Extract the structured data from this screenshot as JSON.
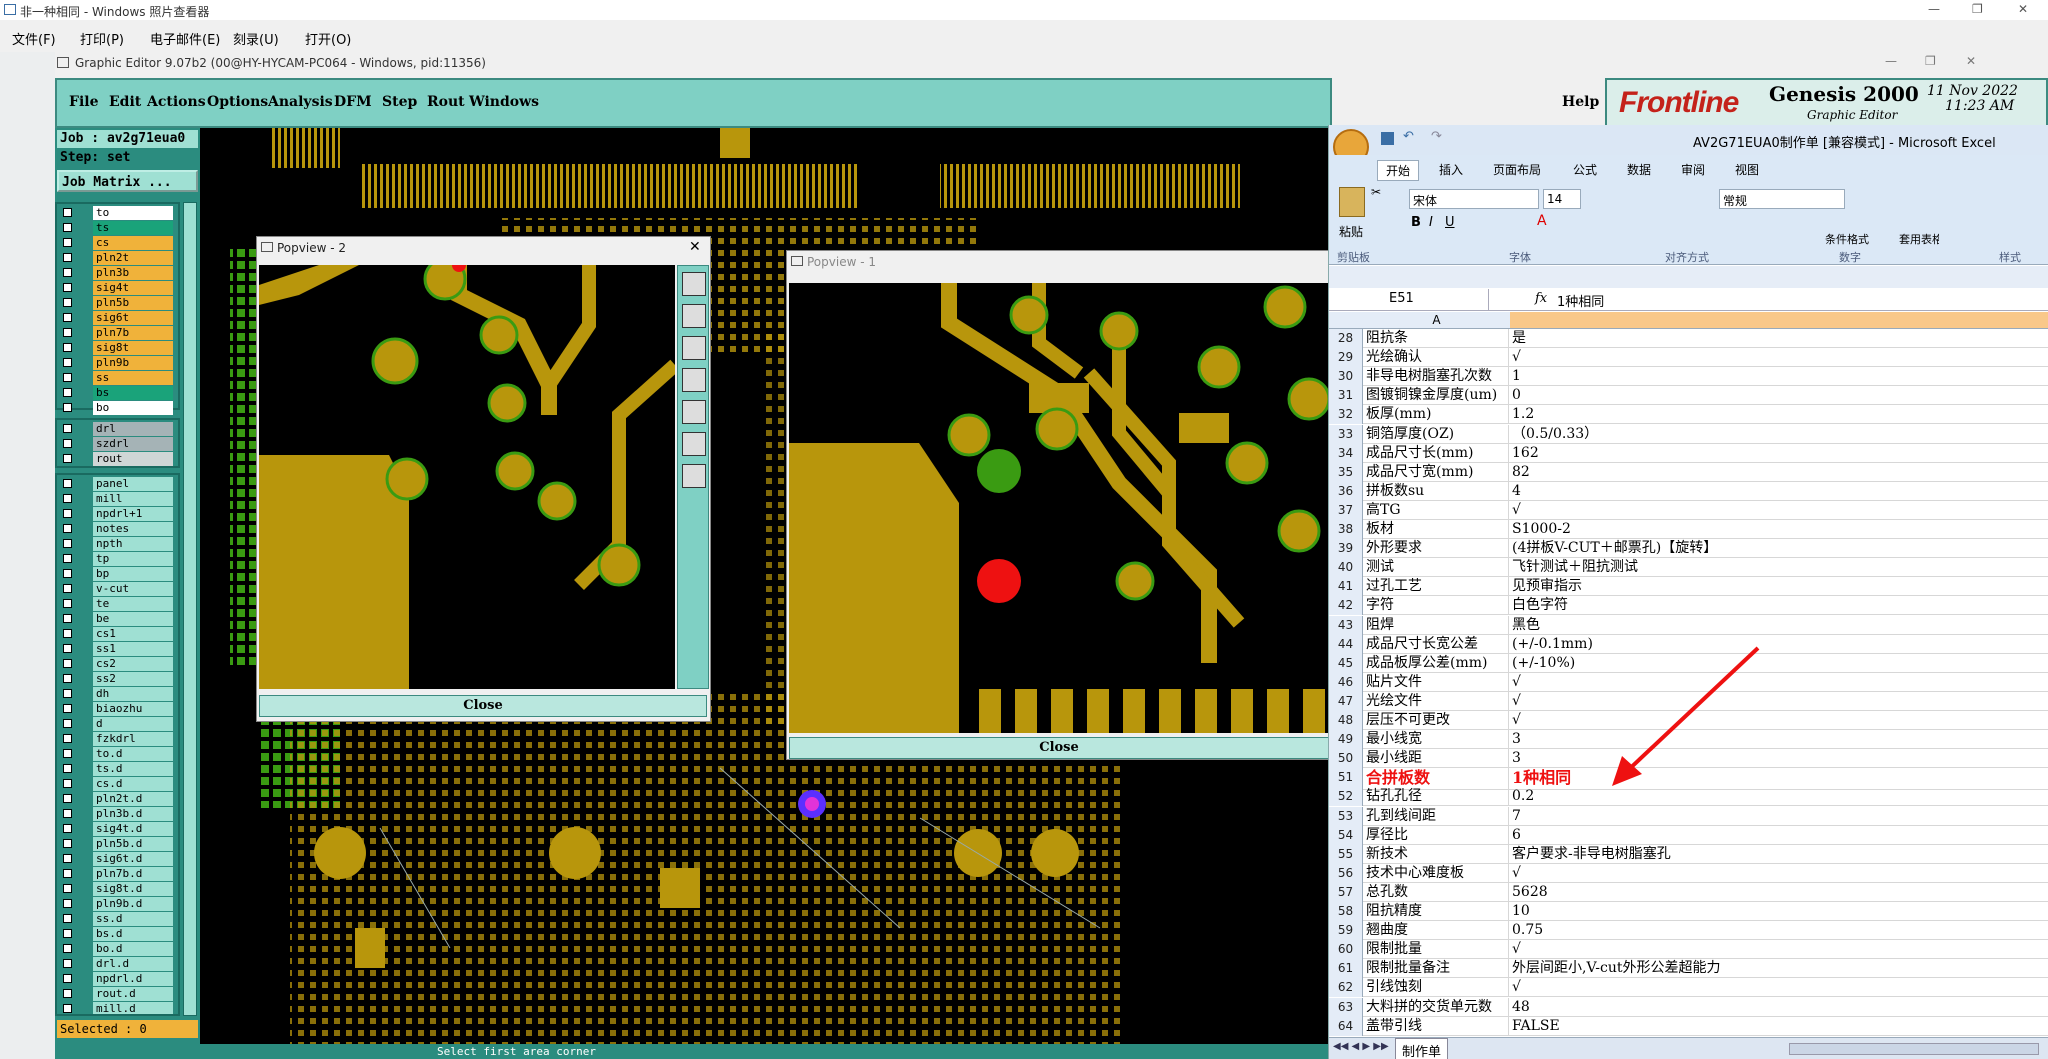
{
  "viewer": {
    "title": "非一种相同 - Windows 照片查看器",
    "menu": [
      "文件(F)",
      "打印(P)",
      "电子邮件(E)",
      "刻录(U)",
      "打开(O)"
    ]
  },
  "genesis": {
    "title": "Graphic Editor 9.07b2 (00@HY-HYCAM-PC064 - Windows, pid:11356)",
    "menu": [
      "File",
      "Edit",
      "Actions",
      "Options",
      "Analysis",
      "DFM",
      "Step",
      "Rout",
      "Windows"
    ],
    "help": "Help",
    "brand": "Frontline",
    "product": "Genesis 2000",
    "subproduct": "Graphic Editor",
    "date": "11 Nov 2022",
    "time": "11:23 AM",
    "job": "Job : av2g71eua0",
    "step": "Step: set",
    "job_matrix": "Job Matrix ...",
    "selected": "Selected : 0",
    "status_text": "Select first area corner",
    "colors": {
      "teal": "#7fd0c4",
      "panel": "#2b8c7f",
      "copper": "#b8960c",
      "pad_green": "#3a9b12"
    },
    "layers_group1": [
      {
        "name": "to",
        "color": "#ffffff"
      },
      {
        "name": "ts",
        "color": "#1aa37a"
      },
      {
        "name": "cs",
        "color": "#f0b23a"
      },
      {
        "name": "pln2t",
        "color": "#f0b23a"
      },
      {
        "name": "pln3b",
        "color": "#f0b23a"
      },
      {
        "name": "sig4t",
        "color": "#f0b23a"
      },
      {
        "name": "pln5b",
        "color": "#f0b23a"
      },
      {
        "name": "sig6t",
        "color": "#f0b23a"
      },
      {
        "name": "pln7b",
        "color": "#f0b23a"
      },
      {
        "name": "sig8t",
        "color": "#f0b23a"
      },
      {
        "name": "pln9b",
        "color": "#f0b23a"
      },
      {
        "name": "ss",
        "color": "#f0b23a"
      },
      {
        "name": "bs",
        "color": "#1aa37a"
      },
      {
        "name": "bo",
        "color": "#ffffff"
      }
    ],
    "layers_group2": [
      {
        "name": "drl",
        "color": "#a5b3b6"
      },
      {
        "name": "szdrl",
        "color": "#a5b3b6"
      },
      {
        "name": "rout",
        "color": "#cfd6d6"
      }
    ],
    "layers_group3": [
      "panel",
      "mill",
      "npdrl+1",
      "notes",
      "npth",
      "tp",
      "bp",
      "v-cut",
      "te",
      "be",
      "cs1",
      "ss1",
      "cs2",
      "ss2",
      "dh",
      "biaozhu",
      "d",
      "fzkdrl",
      "to.d",
      "ts.d",
      "cs.d",
      "pln2t.d",
      "pln3b.d",
      "sig4t.d",
      "pln5b.d",
      "sig6t.d",
      "pln7b.d",
      "sig8t.d",
      "pln9b.d",
      "ss.d",
      "bs.d",
      "bo.d",
      "drl.d",
      "npdrl.d",
      "rout.d",
      "mill.d"
    ],
    "popview2": {
      "title": "Popview - 2",
      "close": "Close"
    },
    "popview1": {
      "title": "Popview - 1",
      "close": "Close"
    }
  },
  "excel": {
    "title": "AV2G71EUA0制作单 [兼容模式] - Microsoft Excel",
    "tabs": [
      "开始",
      "插入",
      "页面布局",
      "公式",
      "数据",
      "审阅",
      "视图"
    ],
    "font_name": "宋体",
    "font_size": "14",
    "number_format": "常规",
    "paste": "粘贴",
    "groups": [
      "剪贴板",
      "字体",
      "对齐方式",
      "数字",
      "样式"
    ],
    "cond_format": "条件格式",
    "table_format": "套用表格格式",
    "name_box": "E51",
    "formula": "1种相同",
    "col_a": "A",
    "sheet_tab": "制作单",
    "rows": [
      {
        "n": "28",
        "a": "阻抗条",
        "b": "是"
      },
      {
        "n": "29",
        "a": "光绘确认",
        "b": "√"
      },
      {
        "n": "30",
        "a": "非导电树脂塞孔次数",
        "b": "1"
      },
      {
        "n": "31",
        "a": "图镀铜镍金厚度(um)",
        "b": "0"
      },
      {
        "n": "32",
        "a": "板厚(mm)",
        "b": "1.2"
      },
      {
        "n": "33",
        "a": "铜箔厚度(OZ)",
        "b": "（0.5/0.33）"
      },
      {
        "n": "34",
        "a": "成品尺寸长(mm)",
        "b": "162"
      },
      {
        "n": "35",
        "a": "成品尺寸宽(mm)",
        "b": "82"
      },
      {
        "n": "36",
        "a": "拼板数su",
        "b": "4"
      },
      {
        "n": "37",
        "a": "高TG",
        "b": "√"
      },
      {
        "n": "38",
        "a": "板材",
        "b": "S1000-2"
      },
      {
        "n": "39",
        "a": "外形要求",
        "b": "(4拼板V-CUT＋邮票孔)【旋转】"
      },
      {
        "n": "40",
        "a": "测试",
        "b": "飞针测试＋阻抗测试"
      },
      {
        "n": "41",
        "a": "过孔工艺",
        "b": "见预审指示"
      },
      {
        "n": "42",
        "a": "字符",
        "b": "白色字符"
      },
      {
        "n": "43",
        "a": "阻焊",
        "b": "黑色"
      },
      {
        "n": "44",
        "a": "成品尺寸长宽公差",
        "b": "(+/-0.1mm)"
      },
      {
        "n": "45",
        "a": "成品板厚公差(mm)",
        "b": "(+/-10%)"
      },
      {
        "n": "46",
        "a": "贴片文件",
        "b": "√"
      },
      {
        "n": "47",
        "a": "光绘文件",
        "b": "√"
      },
      {
        "n": "48",
        "a": "层压不可更改",
        "b": "√"
      },
      {
        "n": "49",
        "a": "最小线宽",
        "b": "3"
      },
      {
        "n": "50",
        "a": "最小线距",
        "b": "3"
      },
      {
        "n": "51",
        "a": "合拼板数",
        "b": "1种相同"
      },
      {
        "n": "52",
        "a": "钻孔孔径",
        "b": "0.2"
      },
      {
        "n": "53",
        "a": "孔到线间距",
        "b": "7"
      },
      {
        "n": "54",
        "a": "厚径比",
        "b": "6"
      },
      {
        "n": "55",
        "a": "新技术",
        "b": "客户要求-非导电树脂塞孔"
      },
      {
        "n": "56",
        "a": "技术中心难度板",
        "b": "√"
      },
      {
        "n": "57",
        "a": "总孔数",
        "b": "5628"
      },
      {
        "n": "58",
        "a": "阻抗精度",
        "b": "10"
      },
      {
        "n": "59",
        "a": "翘曲度",
        "b": "0.75"
      },
      {
        "n": "60",
        "a": "限制批量",
        "b": "√"
      },
      {
        "n": "61",
        "a": "限制批量备注",
        "b": "外层间距小,V-cut外形公差超能力"
      },
      {
        "n": "62",
        "a": "引线蚀刻",
        "b": "√"
      },
      {
        "n": "63",
        "a": "大料拼的交货单元数",
        "b": "48"
      },
      {
        "n": "64",
        "a": "盖带引线",
        "b": "FALSE"
      }
    ]
  }
}
